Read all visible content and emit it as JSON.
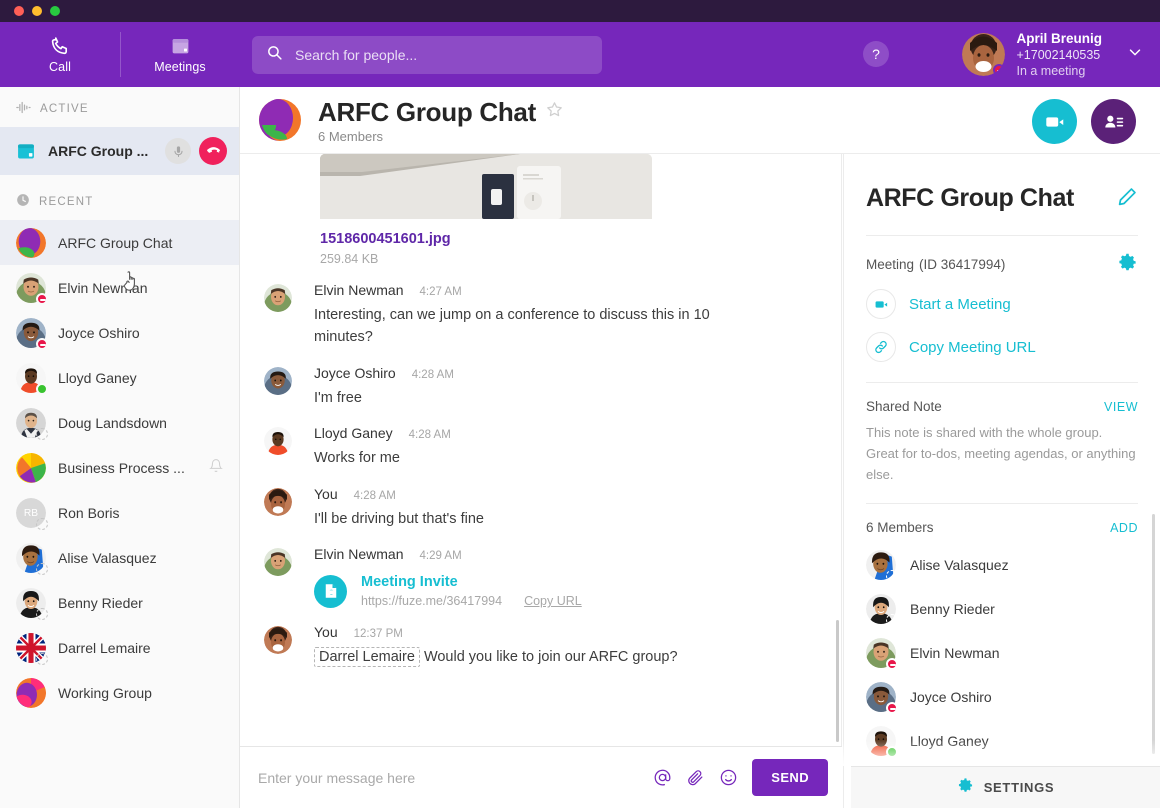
{
  "window": {
    "dots": [
      "close",
      "minimize",
      "zoom"
    ]
  },
  "leftnav": {
    "items": [
      {
        "label": "Call",
        "icon": "phone-icon"
      },
      {
        "label": "Meetings",
        "icon": "calendar-icon"
      }
    ]
  },
  "topbar": {
    "search_placeholder": "Search for people...",
    "help_label": "?",
    "user": {
      "name": "April Breunig",
      "phone": "+17002140535",
      "status": "In a meeting",
      "presence": "busy"
    }
  },
  "sidebar": {
    "active_section": "ACTIVE",
    "recent_section": "RECENT",
    "active_call": {
      "label": "ARFC Group ...",
      "mic_icon": "mic-muted-icon",
      "hangup_icon": "hangup-icon"
    },
    "recent": [
      {
        "label": "ARFC Group Chat",
        "presence": "none",
        "avatar": "group-arfc",
        "selected": true
      },
      {
        "label": "Elvin Newman",
        "presence": "busy",
        "avatar": "elvin"
      },
      {
        "label": "Joyce Oshiro",
        "presence": "busy",
        "avatar": "joyce"
      },
      {
        "label": "Lloyd Ganey",
        "presence": "online",
        "avatar": "lloyd"
      },
      {
        "label": "Doug Landsdown",
        "presence": "offline",
        "avatar": "doug"
      },
      {
        "label": "Business Process ...",
        "presence": "none",
        "avatar": "group-bp",
        "muted": true
      },
      {
        "label": "Ron Boris",
        "presence": "offline",
        "avatar": "initials-RB",
        "initials": "RB"
      },
      {
        "label": "Alise Valasquez",
        "presence": "offline",
        "avatar": "alise"
      },
      {
        "label": "Benny Rieder",
        "presence": "offline",
        "avatar": "benny"
      },
      {
        "label": "Darrel Lemaire",
        "presence": "offline",
        "avatar": "flag-uk"
      },
      {
        "label": "Working Group",
        "presence": "none",
        "avatar": "group-working"
      }
    ]
  },
  "chat_header": {
    "title": "ARFC Group Chat",
    "subtitle": "6 Members",
    "star_icon": "star-outline-icon",
    "video_button": "video-call-button",
    "roster_button": "roster-button"
  },
  "chat": {
    "attachment": {
      "filename": "1518600451601.jpg",
      "filesize": "259.84 KB"
    },
    "messages": [
      {
        "sender": "Elvin Newman",
        "time": "4:27 AM",
        "text": "Interesting, can we jump on a conference to discuss this in 10 minutes?",
        "avatar": "elvin"
      },
      {
        "sender": "Joyce Oshiro",
        "time": "4:28 AM",
        "text": "I'm free",
        "avatar": "joyce"
      },
      {
        "sender": "Lloyd Ganey",
        "time": "4:28 AM",
        "text": "Works for me",
        "avatar": "lloyd"
      },
      {
        "sender": "You",
        "time": "4:28 AM",
        "text": "I'll be driving but that's fine",
        "avatar": "april"
      },
      {
        "sender": "Elvin Newman",
        "time": "4:29 AM",
        "avatar": "elvin",
        "invite": {
          "title": "Meeting Invite",
          "url": "https://fuze.me/36417994",
          "copy_label": "Copy URL"
        }
      },
      {
        "sender": "You",
        "time": "12:37 PM",
        "mention": "Darrel Lemaire",
        "text": "Would you like to join our ARFC group?",
        "avatar": "april"
      }
    ]
  },
  "composer": {
    "placeholder": "Enter your message here",
    "icons": [
      "mention-icon",
      "attachment-icon",
      "emoji-icon"
    ],
    "send_label": "SEND"
  },
  "right_panel": {
    "title": "ARFC Group Chat",
    "edit_icon": "pencil-icon",
    "meeting_label": "Meeting",
    "meeting_id": "(ID 36417994)",
    "settings_gear_icon": "gear-icon",
    "start_meeting": "Start a Meeting",
    "copy_meeting_url": "Copy Meeting URL",
    "shared_note_label": "Shared Note",
    "shared_note_view": "VIEW",
    "shared_note_body": "This note is shared with the whole group. Great for to-dos, meeting agendas, or anything else.",
    "members_label": "6 Members",
    "members_add": "ADD",
    "members": [
      {
        "name": "Alise Valasquez",
        "presence": "offline",
        "avatar": "alise"
      },
      {
        "name": "Benny Rieder",
        "presence": "offline",
        "avatar": "benny"
      },
      {
        "name": "Elvin Newman",
        "presence": "busy",
        "avatar": "elvin"
      },
      {
        "name": "Joyce Oshiro",
        "presence": "busy",
        "avatar": "joyce"
      },
      {
        "name": "Lloyd Ganey",
        "presence": "online",
        "avatar": "lloyd"
      },
      {
        "name": "",
        "presence": "none",
        "avatar": "april"
      }
    ],
    "settings_label": "SETTINGS"
  },
  "colors": {
    "brand_purple": "#7627bb",
    "titlebar": "#2d1a3e",
    "accent_cyan": "#16bed1",
    "dark_purple": "#5b2178",
    "busy_red": "#e8174a",
    "online_green": "#39c32f",
    "hangup_pink": "#f0215c",
    "link_purple": "#5f27a8"
  }
}
